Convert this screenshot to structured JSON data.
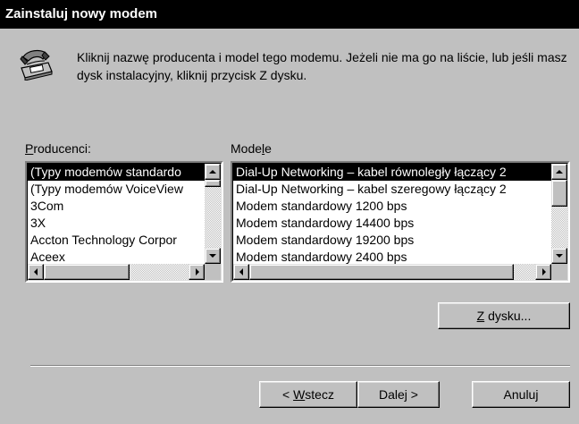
{
  "dialog": {
    "title": "Zainstaluj nowy modem",
    "intro": "Kliknij nazwę producenta i model tego modemu. Jeżeli nie ma go na liście, lub jeśli masz dysk instalacyjny, kliknij przycisk Z dysku.",
    "intro_icon": "modem-phone-icon"
  },
  "manufacturers": {
    "label_hotkey": "P",
    "label_rest": "roducenci:",
    "items": [
      "(Typy modemów standardo",
      "(Typy modemów VoiceView",
      "3Com",
      "3X",
      "Accton Technology Corpor",
      "Aceex"
    ],
    "selected_index": 0
  },
  "models": {
    "label_pre": "Mode",
    "label_hotkey": "l",
    "label_post": "e",
    "items": [
      "Dial-Up Networking – kabel równoległy łączący 2",
      "Dial-Up Networking – kabel szeregowy łączący 2",
      "Modem standardowy 1200 bps",
      "Modem standardowy 14400 bps",
      "Modem standardowy 19200 bps",
      "Modem standardowy 2400 bps"
    ],
    "selected_index": 0
  },
  "buttons": {
    "have_disk_hotkey": "Z",
    "have_disk_rest": " dysku...",
    "back_pre": "< ",
    "back_hotkey": "W",
    "back_rest": "stecz",
    "next": "Dalej >",
    "cancel": "Anuluj"
  }
}
